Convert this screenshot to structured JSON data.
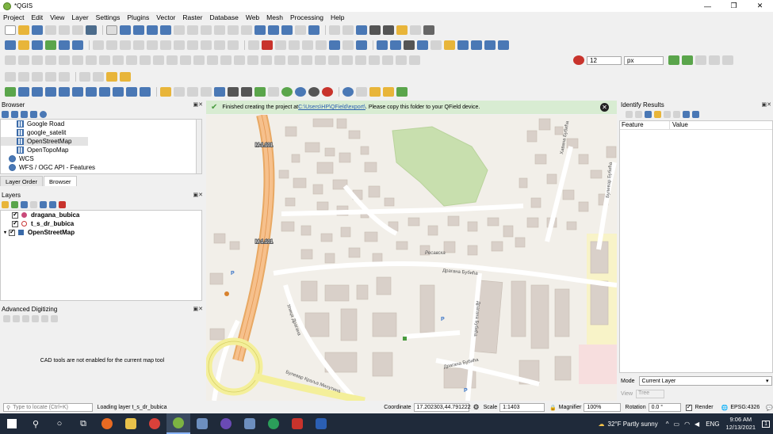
{
  "app": {
    "title": "*QGIS"
  },
  "window_controls": {
    "minimize": "—",
    "maximize": "❐",
    "close": "✕"
  },
  "menu": [
    "Project",
    "Edit",
    "View",
    "Layer",
    "Settings",
    "Plugins",
    "Vector",
    "Raster",
    "Database",
    "Web",
    "Mesh",
    "Processing",
    "Help"
  ],
  "toolbar": {
    "scale_px": "12",
    "unit": "px"
  },
  "message_bar": {
    "prefix": "Finished creating the project at ",
    "link": "C:\\Users\\HP\\QField\\export\\",
    "suffix": ". Please copy this folder to your QField device.",
    "status_color": "#4a9b3f"
  },
  "browser": {
    "title": "Browser",
    "items": [
      {
        "label": "Google Road",
        "icon": "xyz-tile-icon",
        "selected": false
      },
      {
        "label": "google_satelit",
        "icon": "xyz-tile-icon",
        "selected": false
      },
      {
        "label": "OpenStreetMap",
        "icon": "xyz-tile-icon",
        "selected": true
      },
      {
        "label": "OpenTopoMap",
        "icon": "xyz-tile-icon",
        "selected": false
      },
      {
        "label": "WCS",
        "icon": "globe-icon",
        "selected": false
      },
      {
        "label": "WFS / OGC API - Features",
        "icon": "globe-icon",
        "selected": false
      }
    ]
  },
  "tabs": [
    {
      "label": "Layer Order"
    },
    {
      "label": "Browser"
    }
  ],
  "layers": {
    "title": "Layers",
    "items": [
      {
        "label": "dragana_bubica",
        "symbol_color": "#c94a7a"
      },
      {
        "label": "t_s_dr_bubica",
        "symbol_color": "#c83535"
      },
      {
        "label": "OpenStreetMap",
        "symbol_color": "#3a6aa8"
      }
    ]
  },
  "cad": {
    "title": "Advanced Digitizing",
    "message": "CAD tools are not enabled for the current map tool"
  },
  "identify": {
    "title": "Identify Results",
    "col_feature": "Feature",
    "col_value": "Value",
    "mode_label": "Mode",
    "mode_value": "Current Layer",
    "view_label": "View",
    "view_value": "Tree"
  },
  "map_labels": {
    "road1": "M-1.101",
    "road2": "M-1.101",
    "park": "Ресавска",
    "street1": "Драгана Бубића",
    "street2": "Драгана Бубића",
    "street3": "Драгана Бубића",
    "street4": "Хавана Бубића",
    "street5": "Булевар Краља Милутина",
    "street6": "Булевар Бубића",
    "street7": "Улица Драгана",
    "parking": "P"
  },
  "status": {
    "locate_placeholder": "Type to locate (Ctrl+K)",
    "loading": "Loading layer t_s_dr_bubica",
    "coordinate_label": "Coordinate",
    "coordinate_value": "17.202303,44.791222",
    "scale_label": "Scale",
    "scale_value": "1:1403",
    "magnifier_label": "Magnifier",
    "magnifier_value": "100%",
    "rotation_label": "Rotation",
    "rotation_value": "0.0 °",
    "render_label": "Render",
    "crs": "EPSG:4326"
  },
  "taskbar": {
    "weather": "32°F  Partly sunny",
    "lang": "ENG",
    "time": "9:06 AM",
    "date": "12/13/2021",
    "notif": "1"
  }
}
